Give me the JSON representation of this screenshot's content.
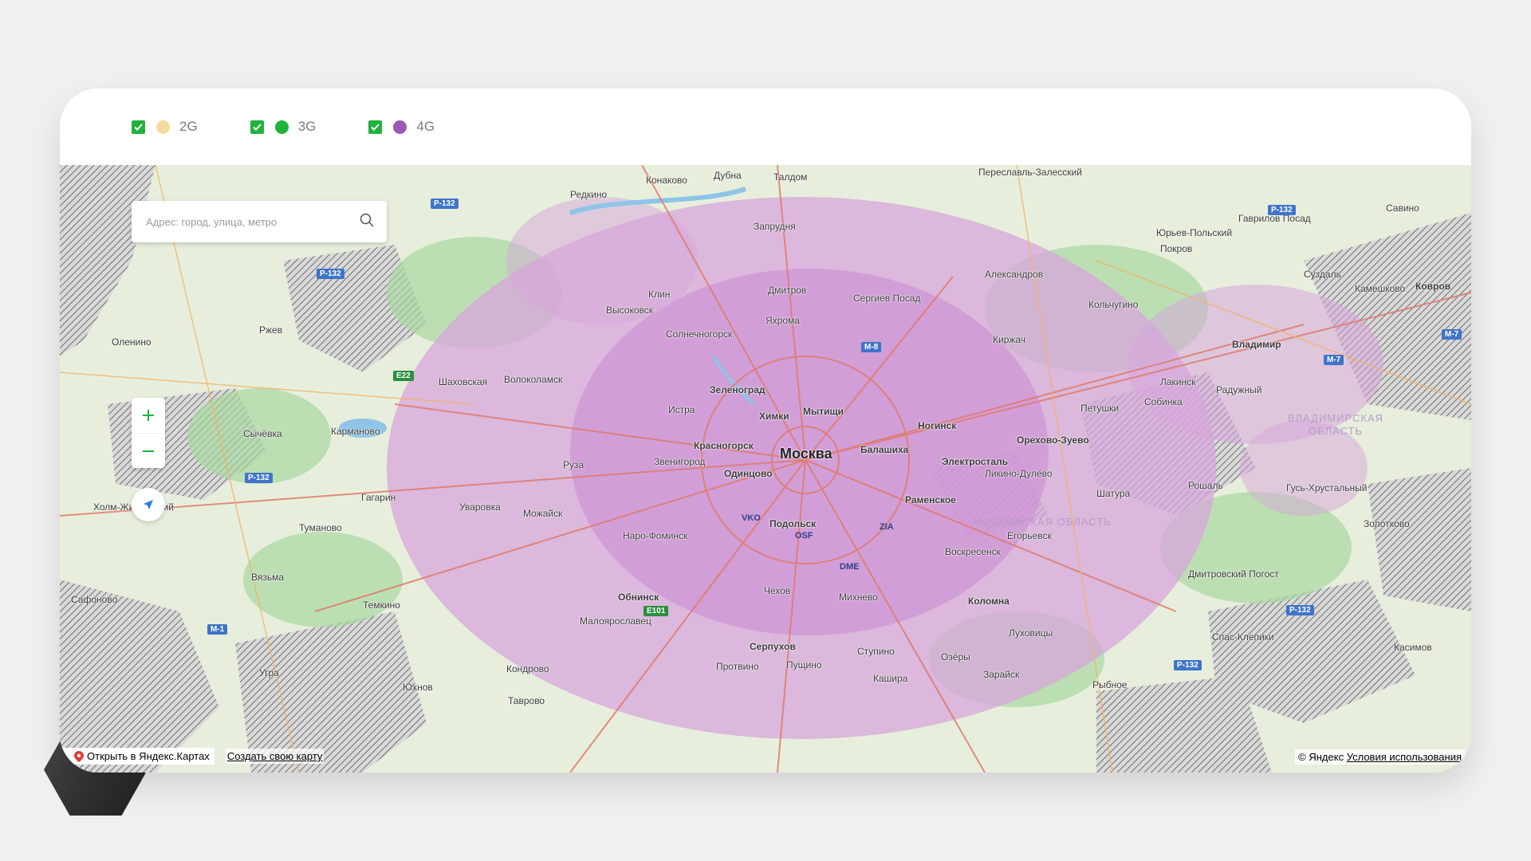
{
  "legend": [
    {
      "label": "2G",
      "checked": true,
      "color": "#f3dba0"
    },
    {
      "label": "3G",
      "checked": true,
      "color": "#1fb33b"
    },
    {
      "label": "4G",
      "checked": true,
      "color": "#9b58b5"
    }
  ],
  "search": {
    "placeholder": "Адрес: город, улица, метро"
  },
  "controls": {
    "zoom_in": "+",
    "zoom_out": "−"
  },
  "footer": {
    "open_in_maps": "Открыть в Яндекс.Картах",
    "create_map": "Создать свою карту",
    "copyright": "© Яндекс",
    "terms": "Условия использования"
  },
  "map": {
    "center_city": "Москва",
    "cities": [
      "Конаково",
      "Талдом",
      "Дубна",
      "Редкино",
      "Запрудня",
      "Клин",
      "Дмитров",
      "Сергиев Посад",
      "Высоковск",
      "Яхрома",
      "Солнечногорск",
      "Зеленоград",
      "Химки",
      "Мытищи",
      "Истра",
      "Красногорск",
      "Балашиха",
      "Ногинск",
      "Электросталь",
      "Орехово-Зуево",
      "Звенигород",
      "Одинцово",
      "Руза",
      "Можайск",
      "Уваровка",
      "Волоколамск",
      "Шаховская",
      "Ржев",
      "Оленино",
      "Сычёвка",
      "Кармановo",
      "Гагарин",
      "Холм-Жирковский",
      "Туманово",
      "Вязьма",
      "Сафоново",
      "Темкино",
      "Угра",
      "Юхнов",
      "Кондрово",
      "Таврово",
      "Малоярославец",
      "Обнинск",
      "Наро-Фоминск",
      "Подольск",
      "Раменское",
      "Ликино-Дулёво",
      "Шатура",
      "Егорьевск",
      "Воскресенск",
      "Коломна",
      "Луховицы",
      "Зарайск",
      "Рыбное",
      "Чехов",
      "Михнево",
      "Серпухов",
      "Пущино",
      "Протвино",
      "Ступино",
      "Кашира",
      "Озёры",
      "Александров",
      "Кольчугино",
      "Киржач",
      "Петушки",
      "Покров",
      "Юрьев-Польский",
      "Гаврилов Посад",
      "Суздаль",
      "Савино",
      "Камешково",
      "Ковров",
      "Владимир",
      "Лакинск",
      "Радужный",
      "Собинка",
      "Гусь-Хрустальный",
      "Рошаль",
      "Дмитровский Погост",
      "Спас-Клепики",
      "Касимов",
      "Золотково",
      "Переславль-Залесский"
    ],
    "regions": [
      "МОСКОВСКАЯ ОБЛАСТЬ",
      "ВЛАДИМИРСКАЯ ОБЛАСТЬ"
    ],
    "roads": [
      "Р-132",
      "Р-132",
      "Р-132",
      "Р-132",
      "Р-132",
      "Р-132",
      "E22",
      "E101",
      "М-1",
      "М-7",
      "М-7",
      "М-8"
    ],
    "airports": [
      "VKO",
      "OSF",
      "DME",
      "ZIA"
    ]
  }
}
